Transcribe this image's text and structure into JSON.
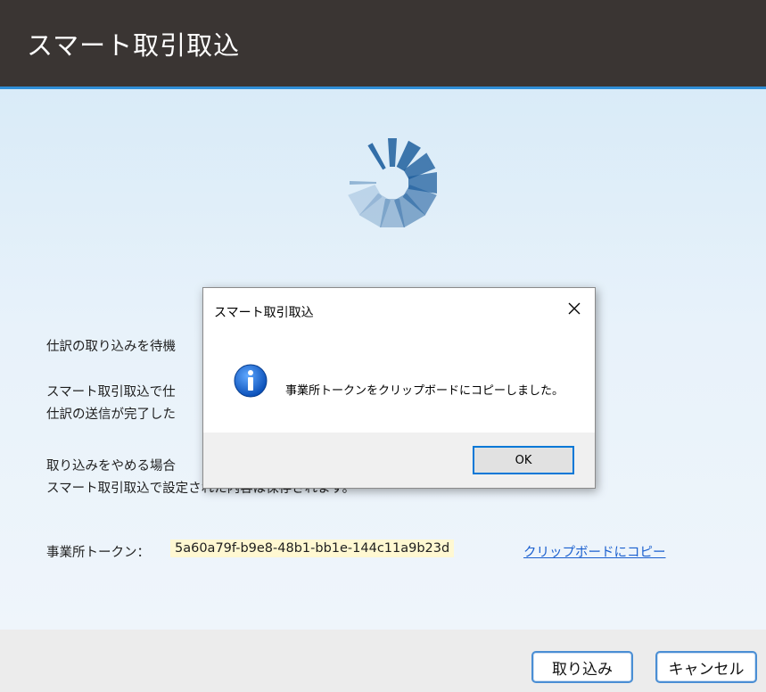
{
  "window": {
    "title": "スマート取引取込"
  },
  "main": {
    "lines": [
      "仕訳の取り込みを待機",
      "スマート取引取込で仕",
      "仕訳の送信が完了した",
      "取り込みをやめる場合",
      "スマート取引取込で設定された内容は保存されます。"
    ],
    "token_label": "事業所トークン：",
    "token_value": "5a60a79f-b9e8-48b1-bb1e-144c11a9b23d",
    "copy_link": "クリップボードにコピー"
  },
  "footer": {
    "import_label": "取り込み",
    "cancel_label": "キャンセル"
  },
  "dialog": {
    "title": "スマート取引取込",
    "message": "事業所トークンをクリップボードにコピーしました。",
    "ok_label": "OK",
    "icon": "info-icon"
  },
  "colors": {
    "titlebar": "#3a3533",
    "accent": "#2f8fd8",
    "link": "#1a5fcf",
    "token_bg": "#fff8d2"
  }
}
